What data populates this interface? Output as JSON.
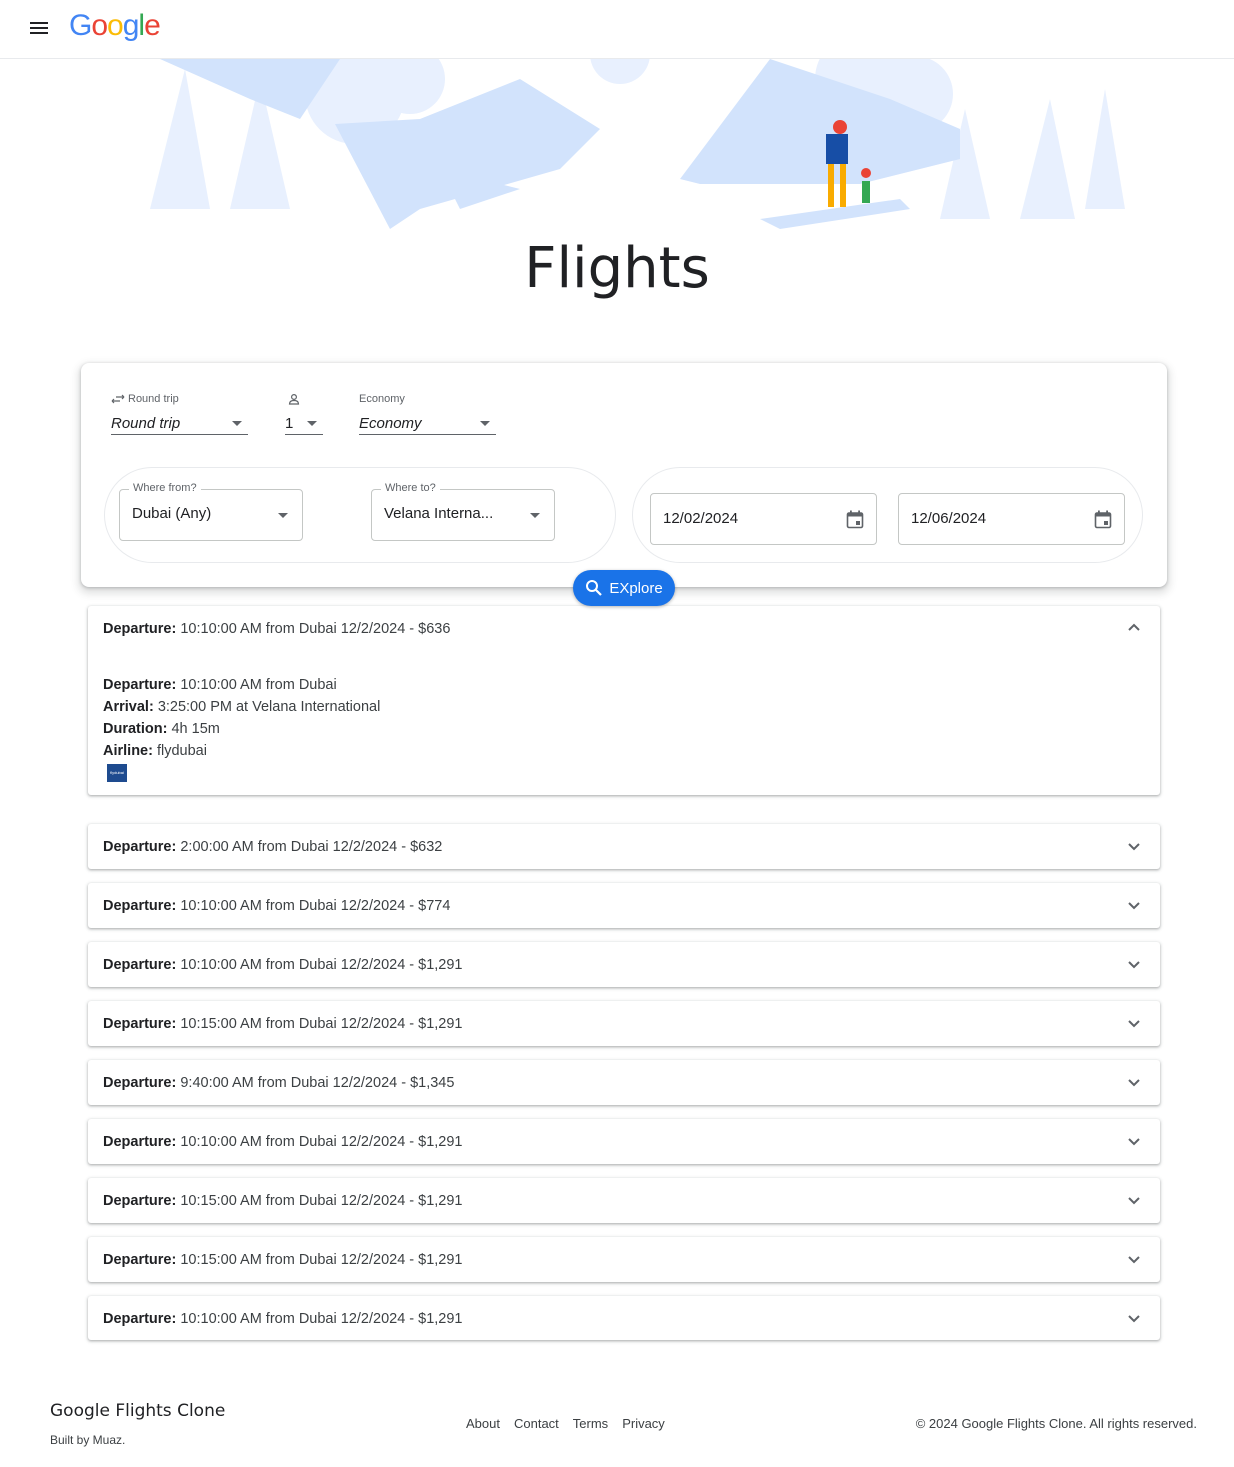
{
  "header": {
    "logo": {
      "G": "G",
      "o1": "o",
      "o2": "o",
      "g": "g",
      "l": "l",
      "e": "e"
    }
  },
  "page": {
    "title": "Flights"
  },
  "search": {
    "trip_type": {
      "label": "Round trip",
      "value": "Round trip"
    },
    "passengers": {
      "value": "1"
    },
    "cabin": {
      "label": "Economy",
      "value": "Economy"
    },
    "from": {
      "label": "Where from?",
      "value": "Dubai (Any)"
    },
    "to": {
      "label": "Where to?",
      "value": "Velana Interna..."
    },
    "depart_date": "12/02/2024",
    "return_date": "12/06/2024",
    "explore_label": "EXplore"
  },
  "flights": [
    {
      "label": "Departure:",
      "summary": "10:10:00 AM from Dubai 12/2/2024 - $636",
      "expanded": true,
      "details": {
        "departure_label": "Departure:",
        "departure": "10:10:00 AM from Dubai",
        "arrival_label": "Arrival:",
        "arrival": "3:25:00 PM at Velana International",
        "duration_label": "Duration:",
        "duration": "4h 15m",
        "airline_label": "Airline:",
        "airline": "flydubai"
      }
    },
    {
      "label": "Departure:",
      "summary": "2:00:00 AM from Dubai 12/2/2024 - $632"
    },
    {
      "label": "Departure:",
      "summary": "10:10:00 AM from Dubai 12/2/2024 - $774"
    },
    {
      "label": "Departure:",
      "summary": "10:10:00 AM from Dubai 12/2/2024 - $1,291"
    },
    {
      "label": "Departure:",
      "summary": "10:15:00 AM from Dubai 12/2/2024 - $1,291"
    },
    {
      "label": "Departure:",
      "summary": "9:40:00 AM from Dubai 12/2/2024 - $1,345"
    },
    {
      "label": "Departure:",
      "summary": "10:10:00 AM from Dubai 12/2/2024 - $1,291"
    },
    {
      "label": "Departure:",
      "summary": "10:15:00 AM from Dubai 12/2/2024 - $1,291"
    },
    {
      "label": "Departure:",
      "summary": "10:15:00 AM from Dubai 12/2/2024 - $1,291"
    },
    {
      "label": "Departure:",
      "summary": "10:10:00 AM from Dubai 12/2/2024 - $1,291"
    }
  ],
  "footer": {
    "brand": "Google Flights Clone",
    "built_by": "Built by Muaz.",
    "links": [
      "About",
      "Contact",
      "Terms",
      "Privacy"
    ],
    "copyright": "© 2024 Google Flights Clone. All rights reserved."
  },
  "colors": {
    "accent": "#1a73e8",
    "hero_mountains": "#d2e3fc",
    "airline_logo": "#1e4b8f"
  }
}
